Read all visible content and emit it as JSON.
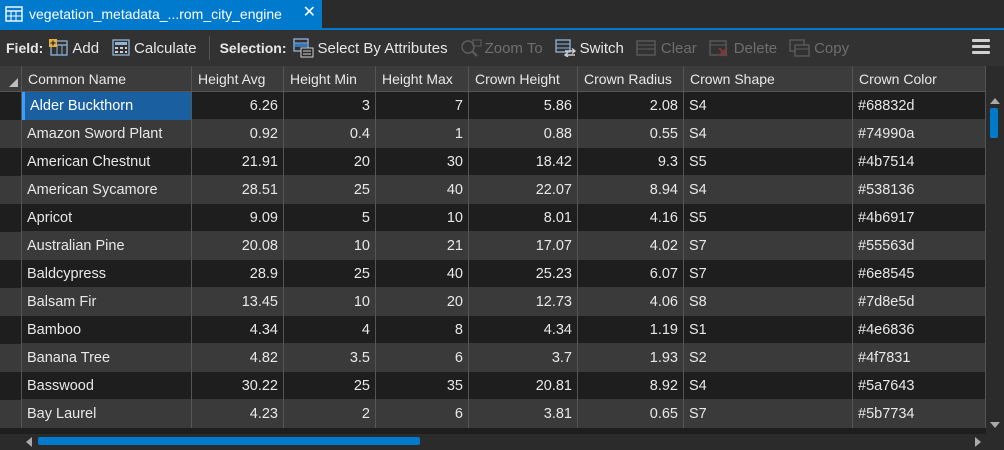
{
  "tab": {
    "title": "vegetation_metadata_...rom_city_engine",
    "close_glyph": "✕"
  },
  "toolbar": {
    "field_label": "Field:",
    "add_label": "Add",
    "calculate_label": "Calculate",
    "selection_label": "Selection:",
    "select_by_attributes_label": "Select By Attributes",
    "zoom_to_label": "Zoom To",
    "switch_label": "Switch",
    "clear_label": "Clear",
    "delete_label": "Delete",
    "copy_label": "Copy"
  },
  "table": {
    "columns": [
      "Common Name",
      "Height Avg",
      "Height Min",
      "Height Max",
      "Crown Height",
      "Crown Radius",
      "Crown Shape",
      "Crown Color"
    ],
    "rows": [
      [
        "Alder Buckthorn",
        "6.26",
        "3",
        "7",
        "5.86",
        "2.08",
        "S4",
        "#68832d"
      ],
      [
        "Amazon Sword Plant",
        "0.92",
        "0.4",
        "1",
        "0.88",
        "0.55",
        "S4",
        "#74990a"
      ],
      [
        "American Chestnut",
        "21.91",
        "20",
        "30",
        "18.42",
        "9.3",
        "S5",
        "#4b7514"
      ],
      [
        "American Sycamore",
        "28.51",
        "25",
        "40",
        "22.07",
        "8.94",
        "S4",
        "#538136"
      ],
      [
        "Apricot",
        "9.09",
        "5",
        "10",
        "8.01",
        "4.16",
        "S5",
        "#4b6917"
      ],
      [
        "Australian Pine",
        "20.08",
        "10",
        "21",
        "17.07",
        "4.02",
        "S7",
        "#55563d"
      ],
      [
        "Baldcypress",
        "28.9",
        "25",
        "40",
        "25.23",
        "6.07",
        "S7",
        "#6e8545"
      ],
      [
        "Balsam Fir",
        "13.45",
        "10",
        "20",
        "12.73",
        "4.06",
        "S8",
        "#7d8e5d"
      ],
      [
        "Bamboo",
        "4.34",
        "4",
        "8",
        "4.34",
        "1.19",
        "S1",
        "#4e6836"
      ],
      [
        "Banana Tree",
        "4.82",
        "3.5",
        "6",
        "3.7",
        "1.93",
        "S2",
        "#4f7831"
      ],
      [
        "Basswood",
        "30.22",
        "25",
        "35",
        "20.81",
        "8.92",
        "S4",
        "#5a7643"
      ],
      [
        "Bay Laurel",
        "4.23",
        "2",
        "6",
        "3.81",
        "0.65",
        "S7",
        "#5b7734"
      ]
    ]
  },
  "colors": {
    "accent": "#007acc",
    "selected_cell": "#1a5fa0",
    "row_dark": "#1e1e1e",
    "row_light": "#3a3a3a"
  }
}
